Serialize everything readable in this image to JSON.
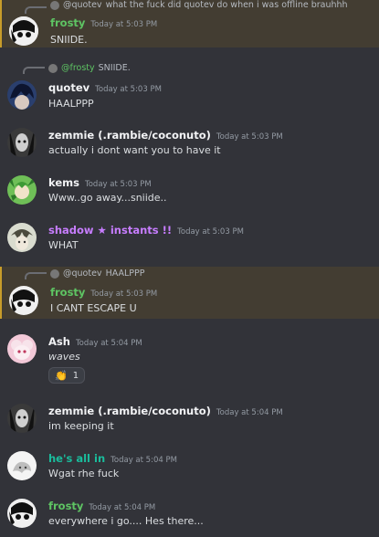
{
  "messages": [
    {
      "reply": {
        "user": "@quotev",
        "text": "what the fuck did quotev do when i was offline brauhhh"
      },
      "author": "frosty",
      "time": "Today at 5:03 PM",
      "content": "SNIIDE."
    },
    {
      "reply": {
        "user": "@frosty",
        "text": "SNIIDE."
      },
      "author": "quotev",
      "time": "Today at 5:03 PM",
      "content": "HAALPPP"
    },
    {
      "author": "zemmie (.rambie/coconuto)",
      "time": "Today at 5:03 PM",
      "content": "actually i dont want you to have it"
    },
    {
      "author": "kems",
      "time": "Today at 5:03 PM",
      "content": "Www..go away...sniide.."
    },
    {
      "author": "shadow ★ instants !!",
      "time": "Today at 5:03 PM",
      "content": "WHAT"
    },
    {
      "reply": {
        "user": "@quotev",
        "text": "HAALPPP"
      },
      "author": "frosty",
      "time": "Today at 5:03 PM",
      "content": "I CANT ESCAPE U"
    },
    {
      "author": "Ash",
      "time": "Today at 5:04 PM",
      "content": "waves",
      "reaction": {
        "emoji": "clapping-hands",
        "count": "1"
      }
    },
    {
      "author": "zemmie (.rambie/coconuto)",
      "time": "Today at 5:04 PM",
      "content": "im keeping it"
    },
    {
      "author": "he's all in",
      "time": "Today at 5:04 PM",
      "content": "Wgat rhe fuck"
    },
    {
      "author": "frosty",
      "time": "Today at 5:04 PM",
      "content": "everywhere i go.... Hes there..."
    }
  ],
  "colors": {
    "background": "#323339",
    "mention_highlight": "#433d32",
    "frosty": "#5ec463",
    "shadow": "#c77dff",
    "hes_all_in": "#1abc9c"
  }
}
